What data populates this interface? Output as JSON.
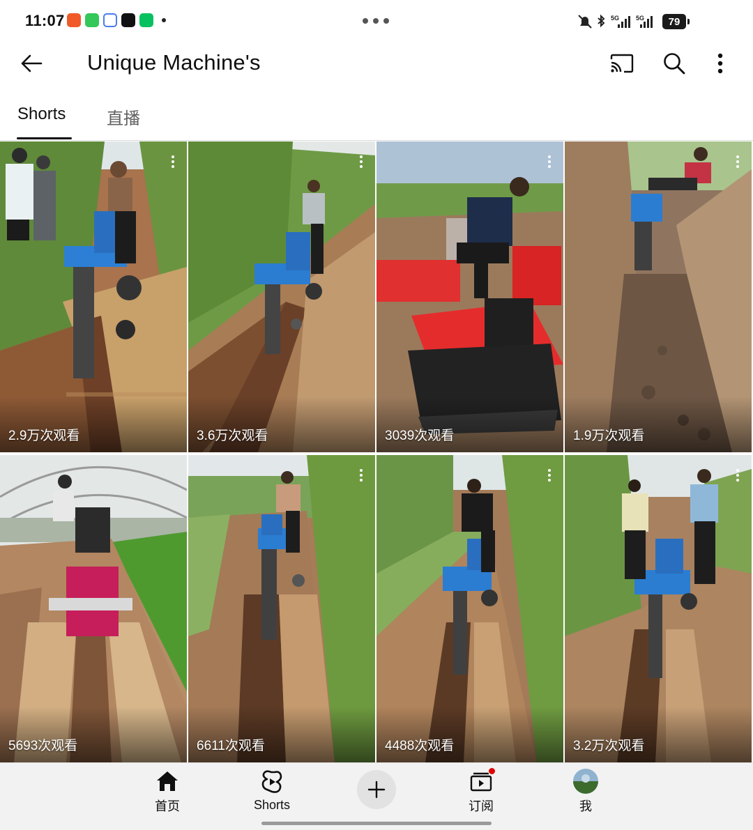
{
  "status_bar": {
    "time": "11:07",
    "signal_1": "5G",
    "signal_2": "5G",
    "battery": "79",
    "app_icons": [
      {
        "name": "pumpkin-app-icon",
        "color": "#f05a28"
      },
      {
        "name": "green-app-icon",
        "color": "#34c759"
      },
      {
        "name": "mail-app-icon",
        "color": "#4a7cf0"
      },
      {
        "name": "tiktok-icon",
        "color": "#111111"
      },
      {
        "name": "wechat-icon",
        "color": "#07c160"
      }
    ]
  },
  "header": {
    "title": "Unique Machine's",
    "icons": [
      "back-arrow-icon",
      "cast-icon",
      "search-icon",
      "more-vert-icon"
    ]
  },
  "tabs": [
    {
      "label": "Shorts",
      "active": true
    },
    {
      "label": "直播",
      "active": false
    }
  ],
  "shorts": [
    {
      "views": "2.9万次观看",
      "scene": "field-trencher-blue"
    },
    {
      "views": "3.6万次观看",
      "scene": "field-trencher-blue"
    },
    {
      "views": "3039次观看",
      "scene": "red-crawler-tractor"
    },
    {
      "views": "1.9万次观看",
      "scene": "deep-trench"
    },
    {
      "views": "5693次观看",
      "scene": "greenhouse-red-machine"
    },
    {
      "views": "6611次观看",
      "scene": "field-trencher-blue"
    },
    {
      "views": "4488次观看",
      "scene": "field-trencher-blue"
    },
    {
      "views": "3.2万次观看",
      "scene": "field-trencher-blue"
    }
  ],
  "bottom_nav": {
    "items": [
      {
        "label": "首页",
        "icon": "home-icon"
      },
      {
        "label": "Shorts",
        "icon": "shorts-icon"
      },
      {
        "label": "订阅",
        "icon": "subscriptions-icon",
        "badge": true
      },
      {
        "label": "我",
        "icon": "avatar"
      }
    ],
    "create_icon": "plus-icon"
  }
}
